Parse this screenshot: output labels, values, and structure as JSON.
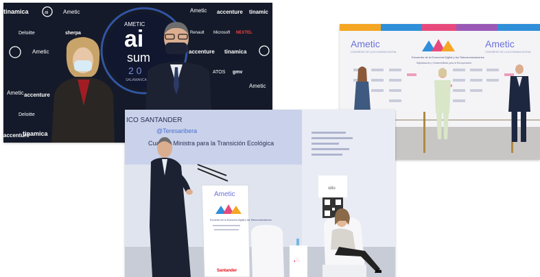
{
  "photos": {
    "summit": {
      "banner_logos": [
        "tinamica",
        "ai",
        "Ametic",
        "accenture",
        "tinamic",
        "Deloitte",
        "sherpa",
        "Renault",
        "Microsoft",
        "NEXTEL",
        "gmv",
        "accenture",
        "tinamica",
        "ATOS",
        "Ametic"
      ],
      "event_brand": "AMETIC",
      "event_ai": "ai",
      "event_sub": "sum",
      "event_year": "2 0",
      "event_org": "SALAMANCA"
    },
    "stage": {
      "left_brand": "Ametic",
      "left_caption": "CONGRESO DE LA ECONOMIA DIGITAL",
      "center_text": "Encuentro de la Economía Digital y las Telecomunicaciones",
      "center_sub": "Digitalización y Sostenibilidad para la Recuperación",
      "right_brand": "Ametic",
      "right_caption": "CONGRESO DE LA ECONOMIA DIGITAL"
    },
    "speech": {
      "screen_name": "ICO SANTANDER",
      "screen_handle": "@Teresaribera",
      "screen_title": "Cuarta y Ministra para la Transición Ecológica",
      "podium_brand": "Ametic",
      "podium_text": "Encuentro de la Economía Digital y las Telecomunicaciones",
      "podium_sponsor": "Santander",
      "side_label": "sitio"
    }
  },
  "colors": {
    "summit_bg": "#121826",
    "stage_accent_pink": "#e8497c",
    "stage_accent_blue": "#2f8fd8",
    "stage_accent_orange": "#f5a623",
    "ametic_purple": "#6a5acd",
    "santander_red": "#e30613"
  }
}
